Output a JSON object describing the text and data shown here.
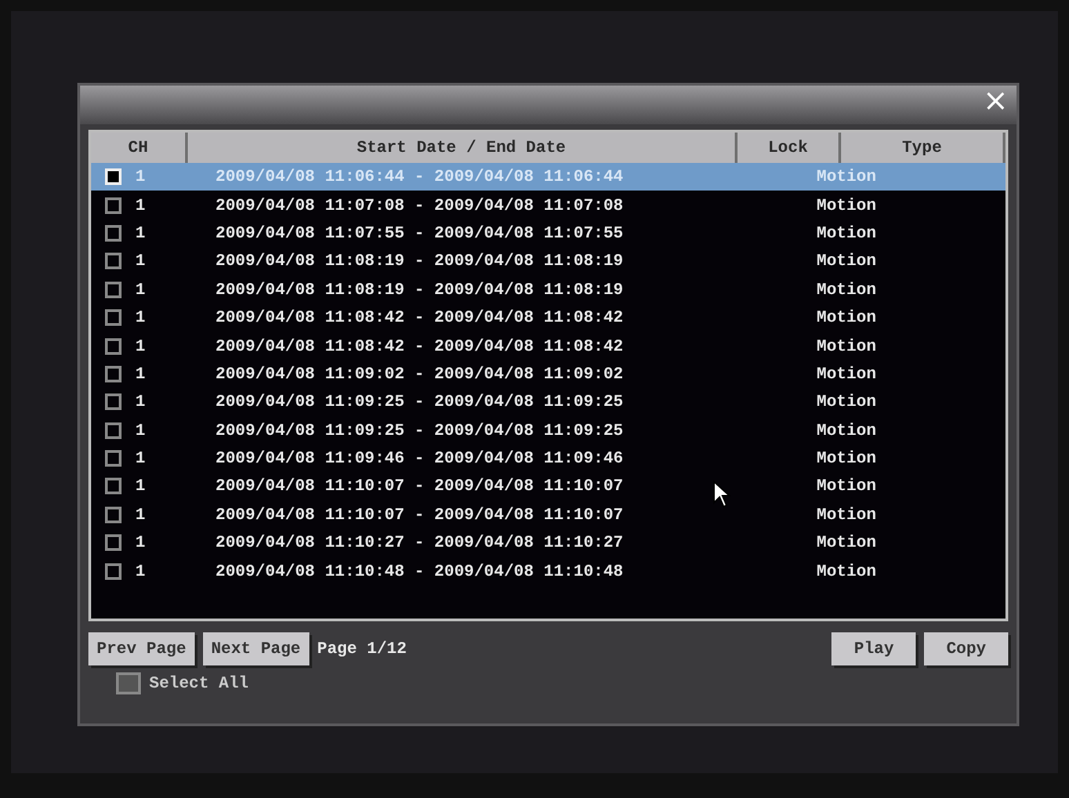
{
  "dialog": {
    "close": "×"
  },
  "table": {
    "columns": [
      "CH",
      "Start Date / End Date",
      "Lock",
      "Type"
    ],
    "rows": [
      {
        "selected": true,
        "checked": false,
        "ch": "1",
        "dates": "2009/04/08 11:06:44 - 2009/04/08 11:06:44",
        "type": "Motion"
      },
      {
        "selected": false,
        "checked": false,
        "ch": "1",
        "dates": "2009/04/08 11:07:08 - 2009/04/08 11:07:08",
        "type": "Motion"
      },
      {
        "selected": false,
        "checked": false,
        "ch": "1",
        "dates": "2009/04/08 11:07:55 - 2009/04/08 11:07:55",
        "type": "Motion"
      },
      {
        "selected": false,
        "checked": false,
        "ch": "1",
        "dates": "2009/04/08 11:08:19 - 2009/04/08 11:08:19",
        "type": "Motion"
      },
      {
        "selected": false,
        "checked": false,
        "ch": "1",
        "dates": "2009/04/08 11:08:19 - 2009/04/08 11:08:19",
        "type": "Motion"
      },
      {
        "selected": false,
        "checked": false,
        "ch": "1",
        "dates": "2009/04/08 11:08:42 - 2009/04/08 11:08:42",
        "type": "Motion"
      },
      {
        "selected": false,
        "checked": false,
        "ch": "1",
        "dates": "2009/04/08 11:08:42 - 2009/04/08 11:08:42",
        "type": "Motion"
      },
      {
        "selected": false,
        "checked": false,
        "ch": "1",
        "dates": "2009/04/08 11:09:02 - 2009/04/08 11:09:02",
        "type": "Motion"
      },
      {
        "selected": false,
        "checked": false,
        "ch": "1",
        "dates": "2009/04/08 11:09:25 - 2009/04/08 11:09:25",
        "type": "Motion"
      },
      {
        "selected": false,
        "checked": false,
        "ch": "1",
        "dates": "2009/04/08 11:09:25 - 2009/04/08 11:09:25",
        "type": "Motion"
      },
      {
        "selected": false,
        "checked": false,
        "ch": "1",
        "dates": "2009/04/08 11:09:46 - 2009/04/08 11:09:46",
        "type": "Motion"
      },
      {
        "selected": false,
        "checked": false,
        "ch": "1",
        "dates": "2009/04/08 11:10:07 - 2009/04/08 11:10:07",
        "type": "Motion"
      },
      {
        "selected": false,
        "checked": false,
        "ch": "1",
        "dates": "2009/04/08 11:10:07 - 2009/04/08 11:10:07",
        "type": "Motion"
      },
      {
        "selected": false,
        "checked": false,
        "ch": "1",
        "dates": "2009/04/08 11:10:27 - 2009/04/08 11:10:27",
        "type": "Motion"
      },
      {
        "selected": false,
        "checked": false,
        "ch": "1",
        "dates": "2009/04/08 11:10:48 - 2009/04/08 11:10:48",
        "type": "Motion"
      }
    ]
  },
  "pager": {
    "prev": "Prev Page",
    "next": "Next Page",
    "page": "Page 1/12"
  },
  "actions": [
    "Play",
    "Copy"
  ],
  "select_all": {
    "label": "Select All",
    "checked": false
  }
}
